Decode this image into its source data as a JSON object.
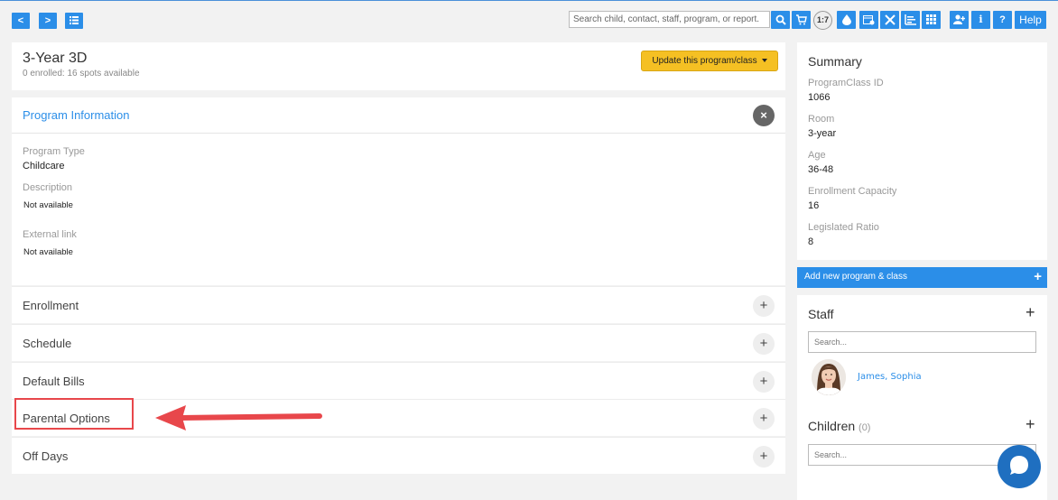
{
  "toolbar": {
    "back_label": "<",
    "forward_label": ">",
    "search_placeholder": "Search child, contact, staff, program, or report.",
    "ratio_label": "1:7",
    "help_label": "Help",
    "icons": [
      "list-icon",
      "search-icon",
      "cart-icon",
      "drop-icon",
      "calendar-icon",
      "close-x-icon",
      "chart-icon",
      "grid-icon",
      "add-user-icon",
      "info-icon",
      "question-icon"
    ]
  },
  "program": {
    "title": "3-Year 3D",
    "subtitle": "0 enrolled: 16 spots available",
    "update_label": "Update this program/class"
  },
  "info": {
    "title": "Program Information",
    "close_label": "×",
    "fields": [
      {
        "label": "Program Type",
        "value": "Childcare"
      },
      {
        "label": "Description",
        "value": "Not available"
      },
      {
        "label": "External link",
        "value": "Not available"
      }
    ]
  },
  "sections": [
    {
      "label": "Enrollment",
      "plus": "+"
    },
    {
      "label": "Schedule",
      "plus": "+"
    },
    {
      "label": "Default Bills",
      "plus": "+"
    },
    {
      "label": "Parental Options",
      "plus": "+"
    },
    {
      "label": "Off Days",
      "plus": "+"
    }
  ],
  "summary": {
    "title": "Summary",
    "fields": [
      {
        "label": "ProgramClass ID",
        "value": "1066"
      },
      {
        "label": "Room",
        "value": "3-year"
      },
      {
        "label": "Age",
        "value": "36-48"
      },
      {
        "label": "Enrollment Capacity",
        "value": "16"
      },
      {
        "label": "Legislated Ratio",
        "value": "8"
      }
    ]
  },
  "add_new": {
    "label": "Add new program & class",
    "plus": "+"
  },
  "staff": {
    "title": "Staff",
    "plus": "+",
    "search_placeholder": "Search...",
    "members": [
      {
        "name": "James, Sophia"
      }
    ]
  },
  "children": {
    "title": "Children",
    "count": "(0)",
    "plus": "+",
    "search_placeholder": "Search..."
  },
  "colors": {
    "accent": "#2b8ee8",
    "update_button": "#f5c023",
    "highlight": "#e8474b",
    "chat": "#1f6fc0"
  }
}
